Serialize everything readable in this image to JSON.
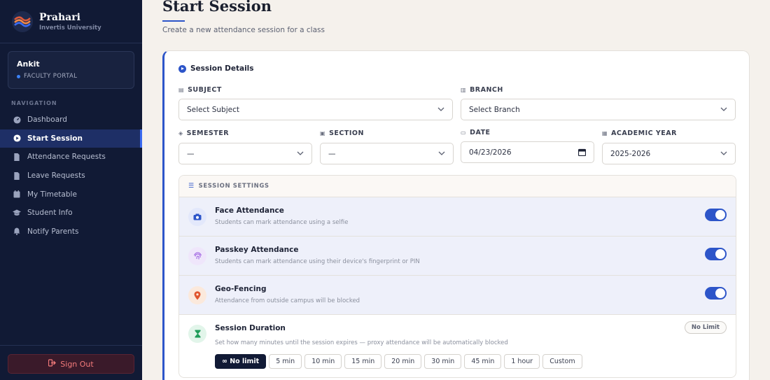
{
  "brand": {
    "name": "Prahari",
    "subtitle": "Invertis University"
  },
  "user": {
    "name": "Ankit",
    "role": "FACULTY PORTAL"
  },
  "nav": {
    "label": "NAVIGATION",
    "items": [
      {
        "label": "Dashboard",
        "icon": "dashboard-icon"
      },
      {
        "label": "Start Session",
        "icon": "play-icon"
      },
      {
        "label": "Attendance Requests",
        "icon": "document-icon"
      },
      {
        "label": "Leave Requests",
        "icon": "document-icon"
      },
      {
        "label": "My Timetable",
        "icon": "calendar-icon"
      },
      {
        "label": "Student Info",
        "icon": "graduation-cap-icon"
      },
      {
        "label": "Notify Parents",
        "icon": "bell-icon"
      }
    ],
    "active": "Start Session"
  },
  "signout": {
    "label": "Sign Out"
  },
  "page": {
    "title": "Start Session",
    "subtitle": "Create a new attendance session for a class"
  },
  "details": {
    "heading": "Session Details",
    "subject": {
      "label": "SUBJECT",
      "value": "Select Subject"
    },
    "branch": {
      "label": "BRANCH",
      "value": "Select Branch"
    },
    "semester": {
      "label": "SEMESTER",
      "value": "—"
    },
    "section": {
      "label": "SECTION",
      "value": "—"
    },
    "date": {
      "label": "DATE",
      "value": "04/23/2026"
    },
    "year": {
      "label": "ACADEMIC YEAR",
      "value": "2025-2026"
    }
  },
  "settings": {
    "heading": "SESSION SETTINGS",
    "face": {
      "title": "Face Attendance",
      "desc": "Students can mark attendance using a selfie",
      "enabled": true
    },
    "passkey": {
      "title": "Passkey Attendance",
      "desc": "Students can mark attendance using their device's fingerprint or PIN",
      "enabled": true
    },
    "geo": {
      "title": "Geo-Fencing",
      "desc": "Attendance from outside campus will be blocked",
      "enabled": true
    },
    "duration": {
      "title": "Session Duration",
      "desc": "Set how many minutes until the session expires — proxy attendance will be automatically blocked",
      "badge": "No Limit",
      "options": [
        "∞ No limit",
        "5 min",
        "10 min",
        "15 min",
        "20 min",
        "30 min",
        "45 min",
        "1 hour",
        "Custom"
      ],
      "selected": "∞ No limit"
    }
  },
  "colors": {
    "accent": "#2d55c9",
    "sidebar": "#111a35",
    "background": "#f5f1ec",
    "danger": "#f27a7a"
  }
}
